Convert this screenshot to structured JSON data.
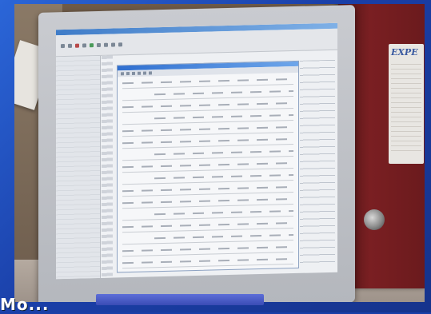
{
  "scene": {
    "slide_background": "#1a3fa8",
    "binder_label": "EXPE",
    "overlay_text": "Мо...",
    "binder_color": "#7a1f22"
  },
  "screen": {
    "app_title_color": "#3f7cc8",
    "document_title_color": "#2f6fd0"
  }
}
